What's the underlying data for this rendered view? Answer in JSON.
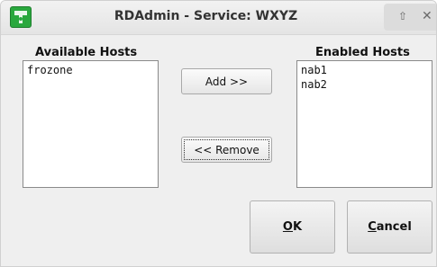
{
  "window": {
    "title": "RDAdmin - Service: WXYZ"
  },
  "available": {
    "heading": "Available Hosts",
    "items": [
      "frozone"
    ]
  },
  "enabled": {
    "heading": "Enabled Hosts",
    "items": [
      "nab1",
      "nab2"
    ]
  },
  "buttons": {
    "add": "Add >>",
    "remove": "<< Remove",
    "ok_mnemonic": "O",
    "ok_rest": "K",
    "cancel_mnemonic": "C",
    "cancel_rest": "ancel"
  },
  "icons": {
    "app": "rdadmin-app-icon",
    "up": "window-up-icon",
    "close": "window-close-icon"
  }
}
